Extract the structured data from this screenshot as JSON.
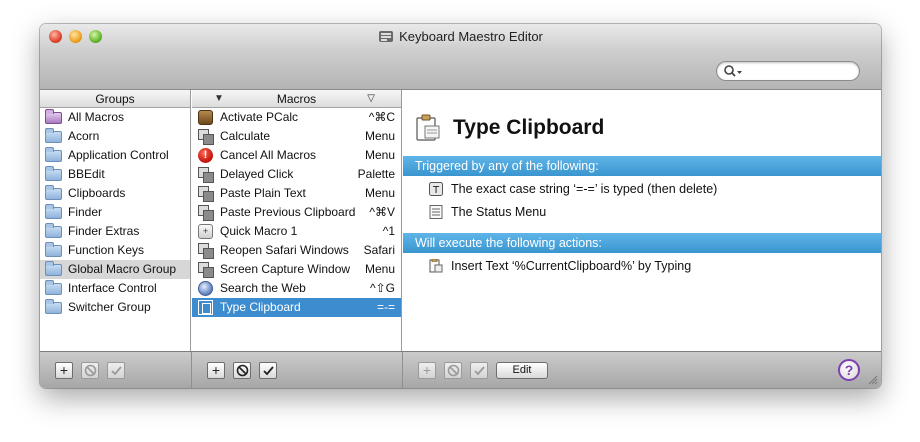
{
  "window": {
    "title": "Keyboard Maestro Editor",
    "search": {
      "value": "",
      "placeholder": ""
    }
  },
  "groups": {
    "header": "Groups",
    "items": [
      {
        "label": "All Macros",
        "icon": "smart-folder-icon"
      },
      {
        "label": "Acorn",
        "icon": "folder-icon"
      },
      {
        "label": "Application Control",
        "icon": "folder-icon"
      },
      {
        "label": "BBEdit",
        "icon": "folder-icon"
      },
      {
        "label": "Clipboards",
        "icon": "folder-icon"
      },
      {
        "label": "Finder",
        "icon": "folder-icon"
      },
      {
        "label": "Finder Extras",
        "icon": "folder-icon"
      },
      {
        "label": "Function Keys",
        "icon": "folder-icon"
      },
      {
        "label": "Global Macro Group",
        "icon": "folder-icon",
        "selected": true
      },
      {
        "label": "Interface Control",
        "icon": "folder-icon"
      },
      {
        "label": "Switcher Group",
        "icon": "folder-icon"
      }
    ]
  },
  "macros": {
    "header": "Macros",
    "sort_left": "▼",
    "sort_right": "▽",
    "items": [
      {
        "label": "Activate PCalc",
        "trigger": "^⌘C",
        "icon": "app-icon"
      },
      {
        "label": "Calculate",
        "trigger": "Menu",
        "icon": "macro-stack-icon"
      },
      {
        "label": "Cancel All Macros",
        "trigger": "Menu",
        "icon": "stop-icon"
      },
      {
        "label": "Delayed Click",
        "trigger": "Palette",
        "icon": "macro-stack-icon"
      },
      {
        "label": "Paste Plain Text",
        "trigger": "Menu",
        "icon": "macro-stack-icon"
      },
      {
        "label": "Paste Previous Clipboard",
        "trigger": "^⌘V",
        "icon": "macro-stack-icon"
      },
      {
        "label": "Quick Macro 1",
        "trigger": "^1",
        "icon": "key-icon"
      },
      {
        "label": "Reopen Safari Windows",
        "trigger": "Safari",
        "icon": "macro-stack-icon"
      },
      {
        "label": "Screen Capture Window",
        "trigger": "Menu",
        "icon": "macro-stack-icon"
      },
      {
        "label": "Search the Web",
        "trigger": "^⇧G",
        "icon": "globe-icon"
      },
      {
        "label": "Type Clipboard",
        "trigger": "=-=",
        "icon": "clipboard-icon",
        "selected": true
      }
    ]
  },
  "detail": {
    "title": "Type Clipboard",
    "triggers_header": "Triggered by any of the following:",
    "triggers": [
      {
        "text": "The exact case string ‘=-=’ is typed (then delete)",
        "icon": "typed-string-icon"
      },
      {
        "text": "The Status Menu",
        "icon": "status-menu-icon"
      }
    ],
    "actions_header": "Will execute the following actions:",
    "actions": [
      {
        "text": "Insert Text ‘%CurrentClipboard%’ by Typing",
        "icon": "insert-text-icon"
      }
    ]
  },
  "toolbar": {
    "add": "+",
    "edit_label": "Edit",
    "help": "?"
  },
  "colors": {
    "selection_blue": "#3d8ccf",
    "section_blue": "#4aa6dd",
    "help_purple": "#7e3fb0"
  }
}
